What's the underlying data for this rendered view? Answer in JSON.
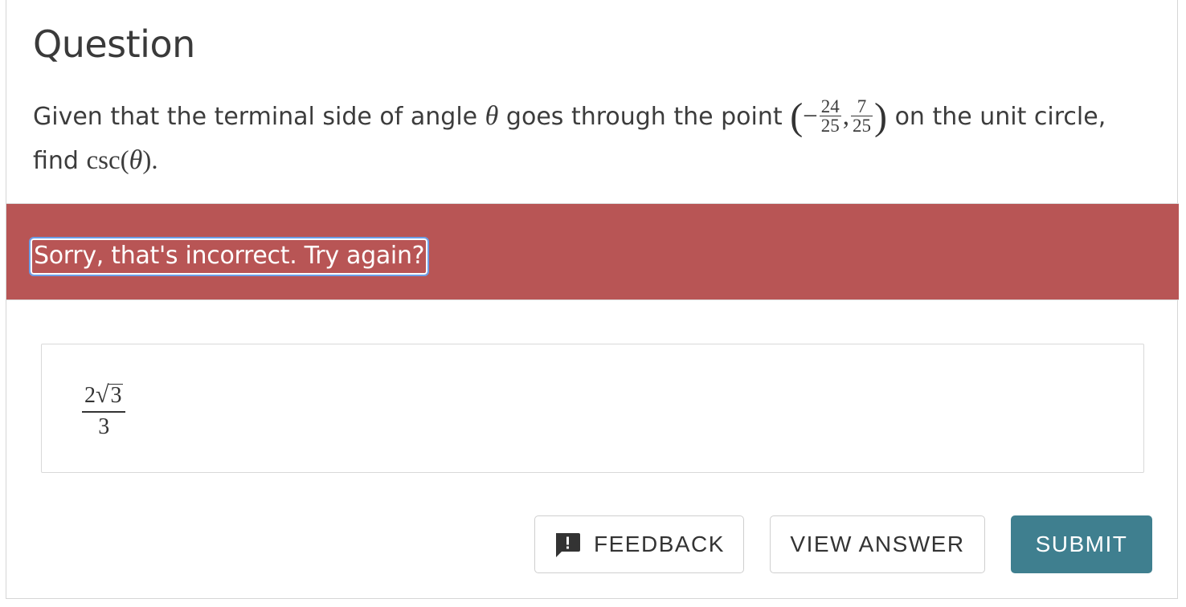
{
  "question": {
    "heading": "Question",
    "prompt_part1": "Given that the terminal side of angle",
    "theta": "θ",
    "prompt_part2": "goes through the point",
    "point": {
      "x_sign": "−",
      "x_num": "24",
      "x_den": "25",
      "y_num": "7",
      "y_den": "25"
    },
    "prompt_part3": "on the unit circle,",
    "prompt_part4": "find",
    "func": "csc(",
    "func_close": ").",
    "comma": ","
  },
  "feedback": {
    "message": "Sorry, that's incorrect. Try again?",
    "banner_color": "#b85555"
  },
  "answer": {
    "coefficient": "2",
    "radical_sign": "√",
    "radicand": "3",
    "denominator": "3"
  },
  "buttons": {
    "feedback_label": "FEEDBACK",
    "feedback_icon": "comment-alert-icon",
    "view_answer_label": "VIEW ANSWER",
    "submit_label": "SUBMIT",
    "submit_color": "#3f7f8f"
  }
}
